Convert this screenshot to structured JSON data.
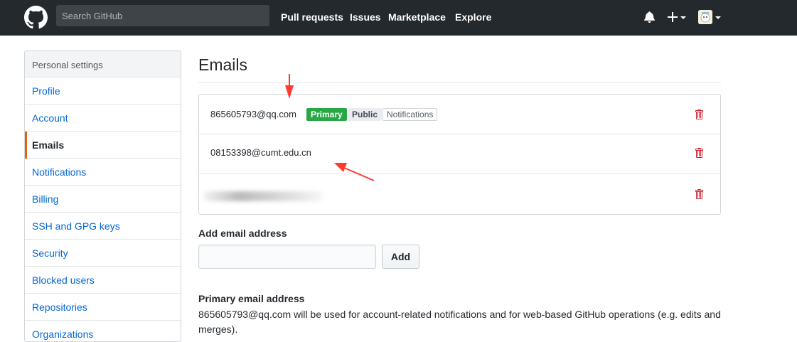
{
  "header": {
    "search_placeholder": "Search GitHub",
    "nav": [
      "Pull requests",
      "Issues",
      "Marketplace",
      "Explore"
    ],
    "icons": [
      "github-logo-icon",
      "bell-icon",
      "plus-icon",
      "avatar"
    ]
  },
  "sidebar": {
    "heading": "Personal settings",
    "items": [
      {
        "label": "Profile",
        "active": false
      },
      {
        "label": "Account",
        "active": false
      },
      {
        "label": "Emails",
        "active": true
      },
      {
        "label": "Notifications",
        "active": false
      },
      {
        "label": "Billing",
        "active": false
      },
      {
        "label": "SSH and GPG keys",
        "active": false
      },
      {
        "label": "Security",
        "active": false
      },
      {
        "label": "Blocked users",
        "active": false
      },
      {
        "label": "Repositories",
        "active": false
      },
      {
        "label": "Organizations",
        "active": false
      }
    ]
  },
  "main": {
    "title": "Emails",
    "emails": [
      {
        "address": "865605793@qq.com",
        "badges": [
          "Primary",
          "Public",
          "Notifications"
        ]
      },
      {
        "address": "08153398@cumt.edu.cn",
        "badges": []
      },
      {
        "address": "",
        "badges": [],
        "blurred": true
      }
    ],
    "add_email": {
      "label": "Add email address",
      "input_value": "",
      "button_label": "Add"
    },
    "primary_section": {
      "label": "Primary email address",
      "description": "865605793@qq.com will be used for account-related notifications and for web-based GitHub operations (e.g. edits and merges)."
    }
  },
  "colors": {
    "header_bg": "#24292e",
    "link": "#0366d6",
    "primary_badge": "#28a745",
    "active_marker": "#e36209",
    "trash": "#cb2431",
    "annotation_arrow": "#ff3b30"
  }
}
